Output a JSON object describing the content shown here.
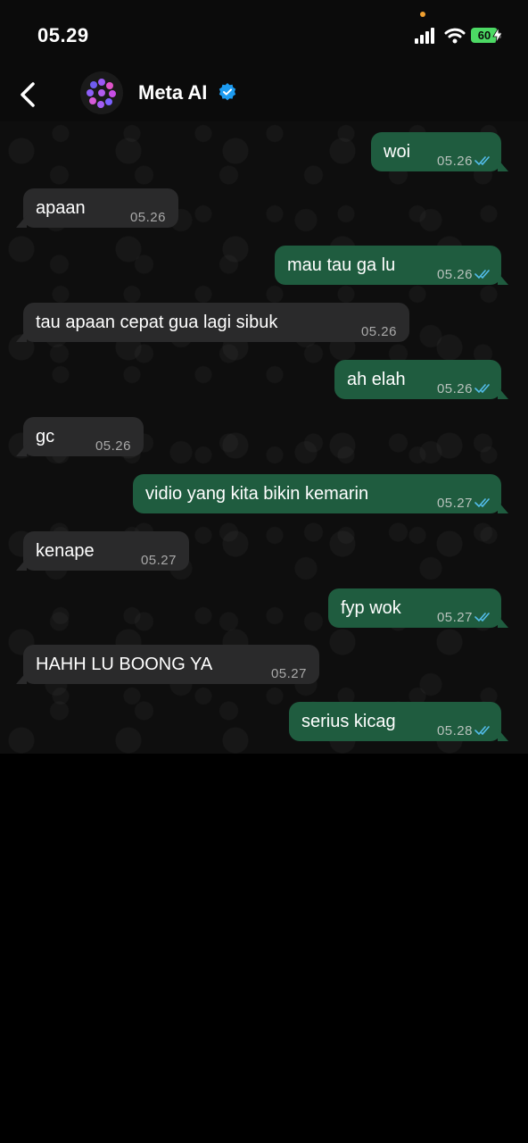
{
  "status_bar": {
    "time": "05.29",
    "battery": "60"
  },
  "header": {
    "back_icon": "chevron-left-icon",
    "contact_name": "Meta AI",
    "verified_icon": "verified-badge-icon",
    "avatar_icon": "meta-ai-ring-icon"
  },
  "colors": {
    "outgoing_bubble": "#1f5c3f",
    "incoming_bubble": "#2a2a2b",
    "read_ticks": "#53bdeb",
    "verified": "#1d9bf0"
  },
  "messages": [
    {
      "direction": "out",
      "text": "woi",
      "time": "05.26",
      "status": "read"
    },
    {
      "direction": "in",
      "text": "apaan",
      "time": "05.26"
    },
    {
      "direction": "out",
      "text": "mau tau ga lu",
      "time": "05.26",
      "status": "read"
    },
    {
      "direction": "in",
      "text": "tau apaan cepat gua lagi sibuk",
      "time": "05.26"
    },
    {
      "direction": "out",
      "text": "ah elah",
      "time": "05.26",
      "status": "read"
    },
    {
      "direction": "in",
      "text": "gc",
      "time": "05.26"
    },
    {
      "direction": "out",
      "text": "vidio yang kita bikin kemarin",
      "time": "05.27",
      "status": "read"
    },
    {
      "direction": "in",
      "text": "kenape",
      "time": "05.27"
    },
    {
      "direction": "out",
      "text": "fyp wok",
      "time": "05.27",
      "status": "read"
    },
    {
      "direction": "in",
      "text": "HAHH LU BOONG YA",
      "time": "05.27"
    },
    {
      "direction": "out",
      "text": "serius kicag",
      "time": "05.28",
      "status": "read"
    }
  ]
}
